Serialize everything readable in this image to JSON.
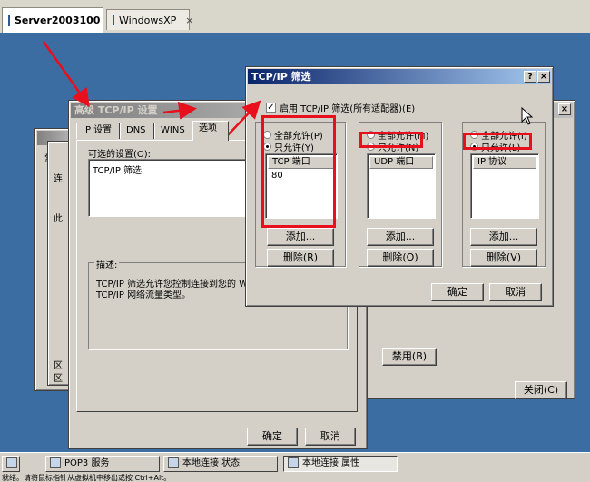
{
  "vm_tabs": [
    {
      "label": "Server2003100",
      "close": "×"
    },
    {
      "label": "WindowsXP",
      "close": "×"
    }
  ],
  "background_fragments": {
    "label1": "常",
    "label2": "连",
    "label3": "此",
    "bottom_left1": "区",
    "bottom_left2": "区",
    "disable_button": "禁用(B)",
    "close_button": "关闭(C)"
  },
  "advanced_dialog": {
    "title": "高级 TCP/IP 设置",
    "tabs": [
      "IP 设置",
      "DNS",
      "WINS",
      "选项"
    ],
    "optional_settings_label": "可选的设置(O):",
    "list_items": [
      "TCP/IP 筛选"
    ],
    "description_label": "描述:",
    "description_text": "TCP/IP 筛选允许您控制连接到您的 Wi",
    "description_text2": "TCP/IP 网络流量类型。",
    "ok_label": "确定",
    "cancel_label": "取消"
  },
  "filter_dialog": {
    "title": "TCP/IP 筛选",
    "help_btn": "?",
    "close_btn": "×",
    "enable_label": "启用 TCP/IP 筛选(所有适配器)(E)",
    "enable_checked": true,
    "columns": [
      {
        "allow_all": "全部允许(P)",
        "allow_only": "只允许(Y)",
        "header": "TCP 端口",
        "items": [
          "80"
        ],
        "add": "添加...",
        "remove": "删除(R)"
      },
      {
        "allow_all": "全部允许(M)",
        "allow_only": "只允许(N)",
        "header": "UDP 端口",
        "items": [],
        "add": "添加...",
        "remove": "删除(O)"
      },
      {
        "allow_all": "全部允许(I)",
        "allow_only": "只允许(L)",
        "header": "IP 协议",
        "items": [],
        "add": "添加...",
        "remove": "删除(V)"
      }
    ],
    "ok_label": "确定",
    "cancel_label": "取消"
  },
  "taskbar": {
    "items": [
      {
        "label": "POP3 服务"
      },
      {
        "label": "本地连接 状态"
      },
      {
        "label": "本地连接 属性"
      }
    ]
  },
  "status_text": "就绪。请将鼠标指针从虚拟机中移出或按 Ctrl+Alt。",
  "colors": {
    "annotation": "#e8101c",
    "title_active": "#0a246a",
    "desktop": "#3b6ca2"
  }
}
